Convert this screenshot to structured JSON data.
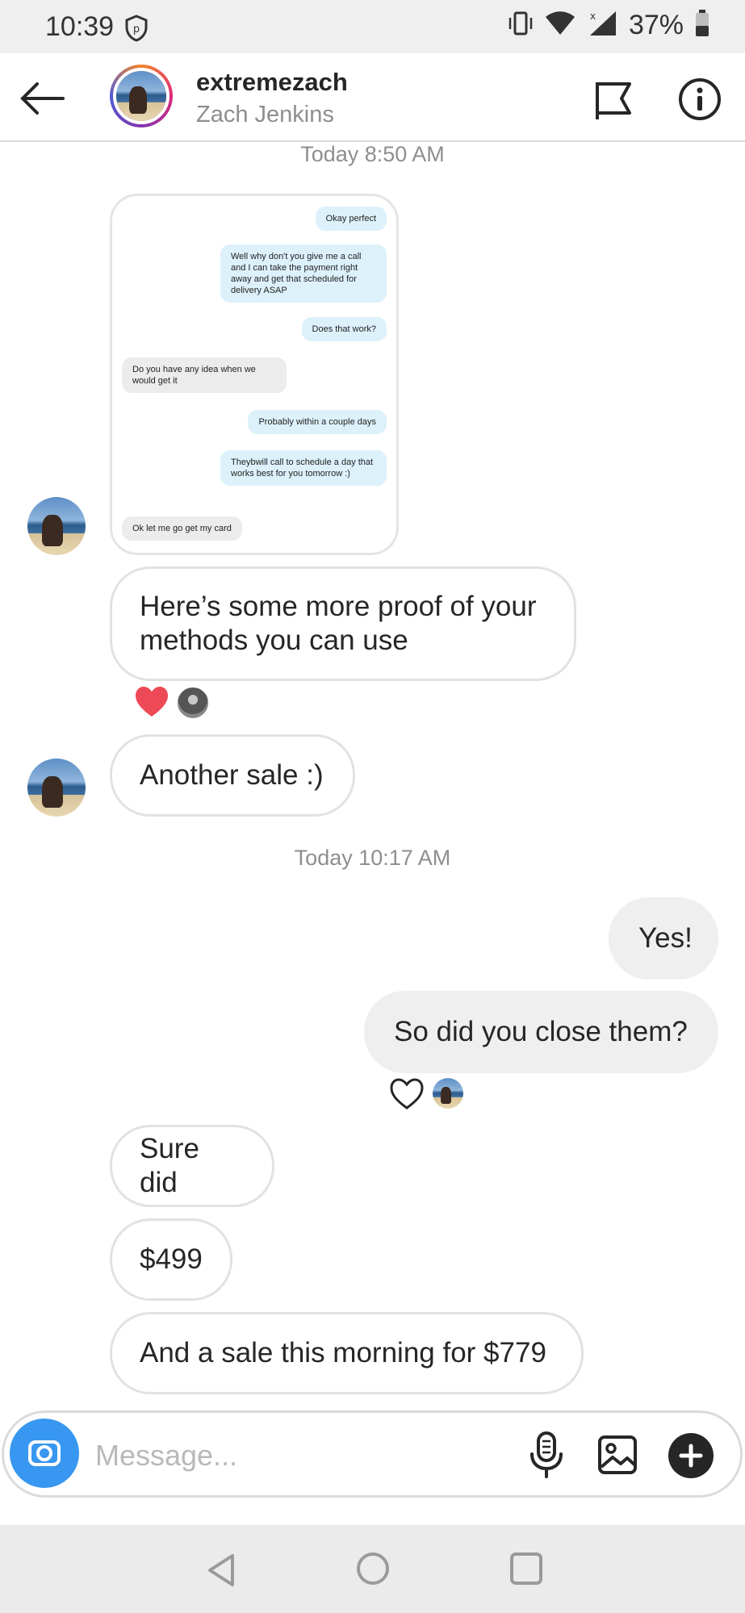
{
  "status_bar": {
    "time": "10:39",
    "battery": "37%"
  },
  "header": {
    "username": "extremezach",
    "real_name": "Zach Jenkins"
  },
  "timestamps": [
    "Today 8:50 AM",
    "Today 10:17 AM"
  ],
  "screenshot_chat": [
    {
      "side": "out",
      "text": "Okay perfect"
    },
    {
      "side": "out",
      "text": "Well why don't you give me a call and I can take the payment right away and get that scheduled for delivery ASAP"
    },
    {
      "side": "out",
      "text": "Does that work?"
    },
    {
      "side": "in",
      "text": "Do you have any idea when we would get it"
    },
    {
      "side": "out",
      "text": "Probably within a couple days"
    },
    {
      "side": "out",
      "text": "Theybwill call to schedule a day that works best for you tomorrow :)"
    },
    {
      "side": "in",
      "text": "Ok let me go get my card"
    }
  ],
  "messages": [
    {
      "side": "in",
      "text": "Here’s some more proof of your methods you can use"
    },
    {
      "side": "in",
      "text": "Another sale :)"
    },
    {
      "side": "out",
      "text": "Yes!"
    },
    {
      "side": "out",
      "text": "So did you close them?"
    },
    {
      "side": "in",
      "text": "Sure did"
    },
    {
      "side": "in",
      "text": "$499"
    },
    {
      "side": "in",
      "text": "And a sale this morning for $779"
    }
  ],
  "composer": {
    "placeholder": "Message..."
  },
  "colors": {
    "accent": "#3897f0",
    "heart": "#ed4956"
  }
}
